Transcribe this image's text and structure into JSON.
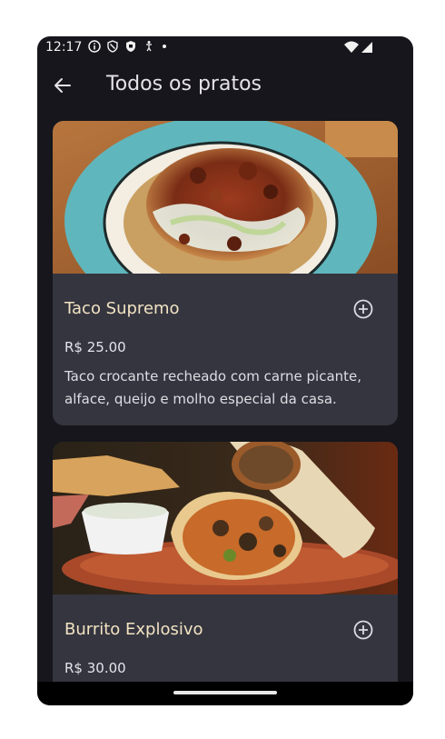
{
  "status_bar": {
    "time": "12:17",
    "icons": [
      "info-icon",
      "shield-outline-icon",
      "shield-filled-icon",
      "accessibility-icon",
      "dot-icon",
      "wifi-icon",
      "signal-icon"
    ]
  },
  "app_bar": {
    "title": "Todos os pratos",
    "back_icon": "arrow-back-icon"
  },
  "dishes": [
    {
      "name": "Taco Supremo",
      "price": "R$ 25.00",
      "description": "Taco crocante recheado com carne picante, alface, queijo e molho especial da casa.",
      "image": "taco-photo",
      "add_icon": "add-circle-icon"
    },
    {
      "name": "Burrito Explosivo",
      "price": "R$ 30.00",
      "image": "burrito-photo",
      "add_icon": "add-circle-icon"
    }
  ],
  "colors": {
    "background": "#16161c",
    "card": "#34353f",
    "dish_name": "#f3e3c2",
    "text": "#e6e4ea"
  }
}
